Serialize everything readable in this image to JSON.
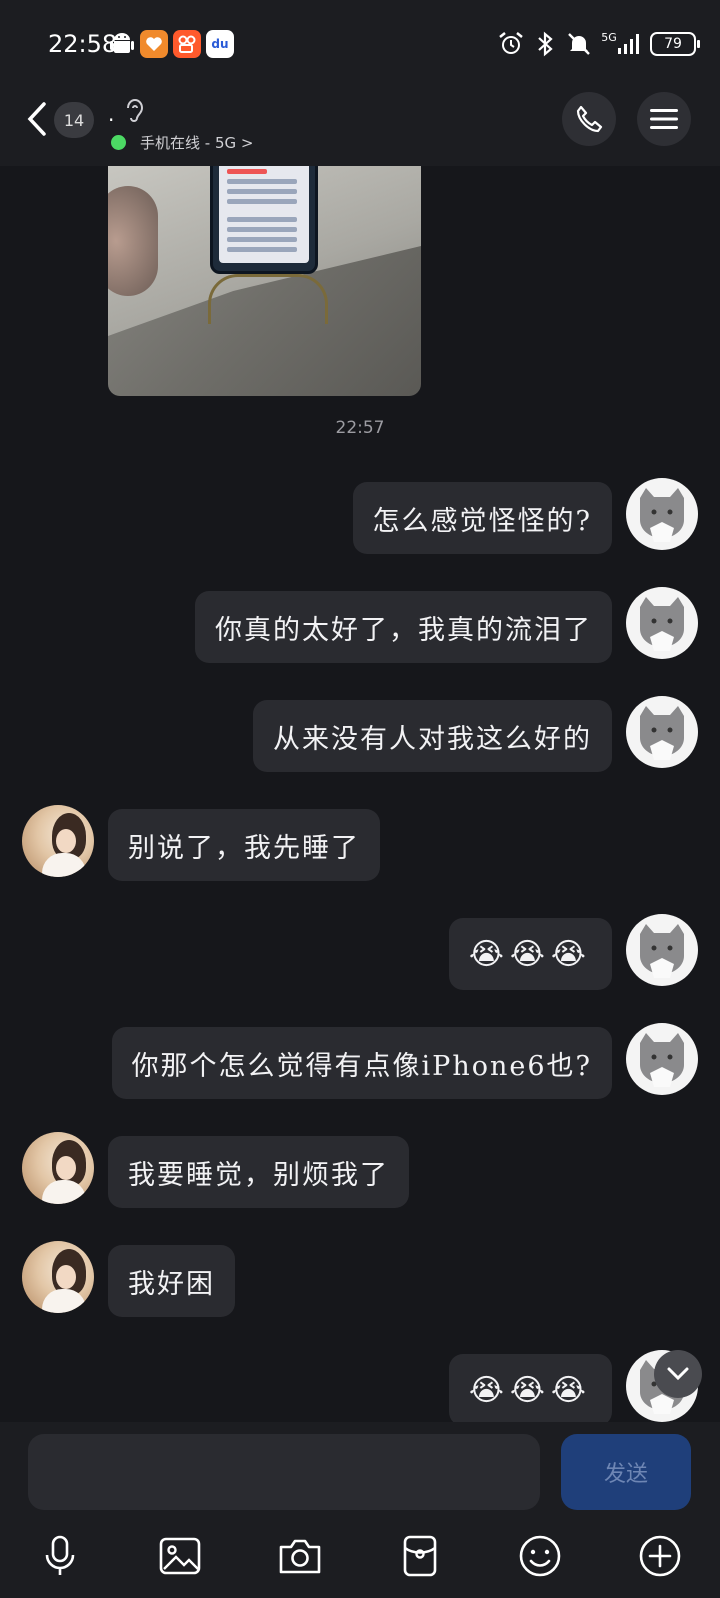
{
  "status_bar": {
    "time": "22:58",
    "network": "5G",
    "battery": "79",
    "app_icons": [
      "android-icon",
      "heart-app-icon",
      "kuaishou-icon",
      "baidu-icon"
    ],
    "baidu_label": "du"
  },
  "header": {
    "unread_count": "14",
    "contact_name": ".",
    "status_text": "手机在线 - 5G >",
    "online_color": "#4cd964"
  },
  "chat": {
    "timestamp": "22:57",
    "messages": [
      {
        "side": "out",
        "text": "怎么感觉怪怪的?"
      },
      {
        "side": "out",
        "text": "你真的太好了，我真的流泪了"
      },
      {
        "side": "out",
        "text": "从来没有人对我这么好的"
      },
      {
        "side": "in",
        "text": "别说了，我先睡了"
      },
      {
        "side": "out",
        "text": "😭😭😭"
      },
      {
        "side": "out",
        "text": "你那个怎么觉得有点像iPhone6也?"
      },
      {
        "side": "in",
        "text": "我要睡觉，别烦我了"
      },
      {
        "side": "in",
        "text": "我好困"
      },
      {
        "side": "out",
        "text": "😭😭😭"
      }
    ]
  },
  "input": {
    "placeholder": "",
    "send_label": "发送",
    "accent": "#1f3f7a"
  },
  "toolbar": [
    "microphone-icon",
    "image-icon",
    "camera-icon",
    "red-packet-icon",
    "emoji-icon",
    "plus-icon"
  ]
}
